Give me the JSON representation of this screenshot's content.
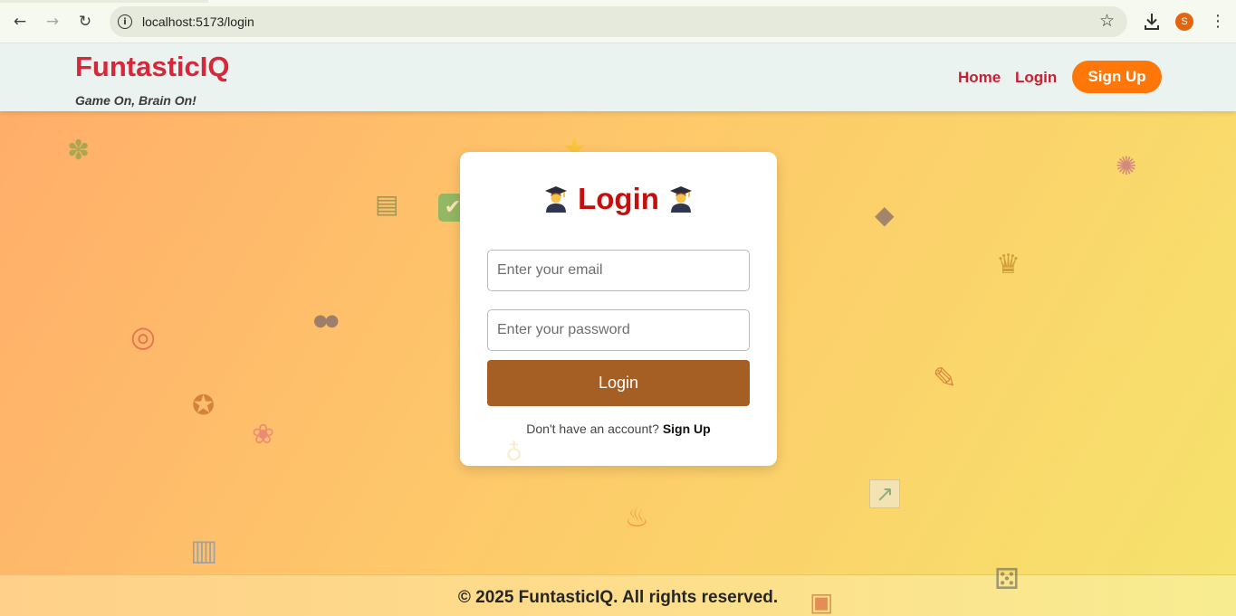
{
  "browser": {
    "url": "localhost:5173/login",
    "back_icon": "arrow-left-icon",
    "forward_icon": "arrow-right-icon",
    "reload_icon": "reload-icon",
    "profile_initial": "S",
    "profile_color": "#e4650f"
  },
  "header": {
    "brand": "FuntasticIQ",
    "tagline": "Game On, Brain On!",
    "nav": {
      "home": "Home",
      "login": "Login",
      "signup": "Sign Up"
    },
    "brand_color": "#d6283a",
    "accent_color": "#fe7708"
  },
  "login_card": {
    "title": "Login",
    "title_icon": "graduate-icon",
    "email_placeholder": "Enter your email",
    "email_value": "",
    "password_placeholder": "Enter your password",
    "password_value": "",
    "submit_label": "Login",
    "prompt_text": "Don't have an account?",
    "prompt_link": "Sign Up",
    "button_color": "#a55f25",
    "title_color": "#c40f0f"
  },
  "decorations": [
    {
      "name": "puzzle-icon",
      "glyph": "✽"
    },
    {
      "name": "books-icon",
      "glyph": "▤"
    },
    {
      "name": "checkmark-icon",
      "glyph": "✔"
    },
    {
      "name": "star-icon",
      "glyph": "★"
    },
    {
      "name": "palette-icon",
      "glyph": "◆"
    },
    {
      "name": "party-popper-icon",
      "glyph": "✺"
    },
    {
      "name": "trophy-icon",
      "glyph": "♛"
    },
    {
      "name": "party-popper-icon",
      "glyph": "✺"
    },
    {
      "name": "people-icon",
      "glyph": "●●"
    },
    {
      "name": "target-icon",
      "glyph": "◎"
    },
    {
      "name": "pencil-icon",
      "glyph": "✎"
    },
    {
      "name": "medal-icon",
      "glyph": "✪"
    },
    {
      "name": "brain-icon",
      "glyph": "❀"
    },
    {
      "name": "potion-icon",
      "glyph": "♁"
    },
    {
      "name": "chart-up-icon",
      "glyph": "↗"
    },
    {
      "name": "fire-icon",
      "glyph": "♨"
    },
    {
      "name": "bar-chart-icon",
      "glyph": "▥"
    },
    {
      "name": "dice-icon",
      "glyph": "⚄"
    },
    {
      "name": "gift-icon",
      "glyph": "▣"
    }
  ],
  "footer": {
    "copyright": "© 2025 FuntasticIQ. All rights reserved."
  }
}
